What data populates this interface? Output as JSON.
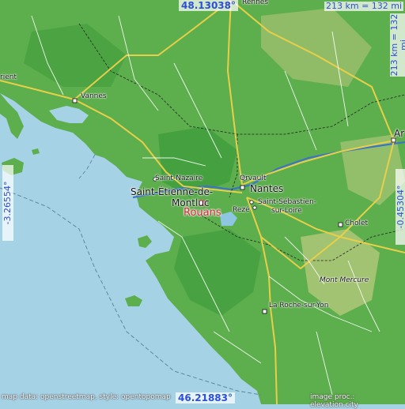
{
  "map": {
    "title": "Rouans",
    "colors": {
      "sea": "#a6d2e6",
      "land": "#5dae4c",
      "land_dark": "#3c9a3a",
      "highland": "#b9c97e",
      "road_motorway": "#e8cf4a",
      "road_major": "#f0e07c",
      "road_minor": "#ffffff",
      "border": "#222222",
      "river": "#3a76c4",
      "marker": "#d8233a",
      "coord_text": "#2b4fd6"
    },
    "coords": {
      "top": "48.13038°",
      "bottom": "46.21883°",
      "left": "-3.26554°",
      "right": "-0.45304°"
    },
    "scale": {
      "top": "213 km = 132 mi",
      "right": "213 km = 132 mi"
    },
    "attribution": {
      "left": "map data: openstreetmap, style: opentopomap",
      "right": "image proc.: elevation.city"
    },
    "places": [
      {
        "name": "Nantes",
        "kind": "city"
      },
      {
        "name": "Saint-Étienne-de-",
        "kind": "city"
      },
      {
        "name": "Montluc",
        "kind": "city"
      },
      {
        "name": "Saint-Nazaire",
        "kind": "town"
      },
      {
        "name": "Orvault",
        "kind": "town"
      },
      {
        "name": "Rezé",
        "kind": "town"
      },
      {
        "name": "Saint-Sébastien-",
        "kind": "town"
      },
      {
        "name": "sur-Loire",
        "kind": "town"
      },
      {
        "name": "Cholet",
        "kind": "town"
      },
      {
        "name": "Vannes",
        "kind": "town"
      },
      {
        "name": "La Roche-sur-Yon",
        "kind": "town"
      },
      {
        "name": "Mont Mercure",
        "kind": "peak"
      },
      {
        "name": "rient",
        "kind": "town"
      },
      {
        "name": "Ar",
        "kind": "town"
      },
      {
        "name": "Rennes",
        "kind": "town"
      }
    ],
    "main_place": "Rouans"
  }
}
